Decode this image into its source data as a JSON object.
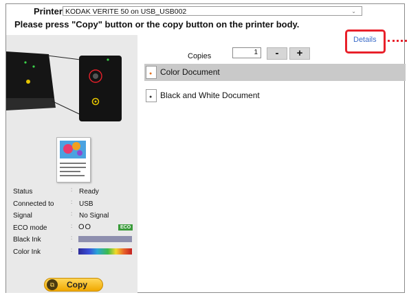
{
  "printer": {
    "label": "Printer:",
    "selected": "KODAK VERITE 50 on USB_USB002"
  },
  "instruction": "Please press \"Copy\" button or the copy button on the printer body.",
  "details_link": "Details",
  "copies": {
    "label": "Copies",
    "value": "1",
    "minus": "-",
    "plus": "+"
  },
  "document_types": [
    {
      "label": "Color Document",
      "selected": true
    },
    {
      "label": "Black and White Document",
      "selected": false
    }
  ],
  "status": {
    "rows": [
      {
        "key": "Status",
        "value": "Ready"
      },
      {
        "key": "Connected to",
        "value": "USB"
      },
      {
        "key": "Signal",
        "value": "No Signal"
      }
    ],
    "eco": {
      "key": "ECO mode",
      "circles": "OO",
      "badge": "ECO"
    },
    "black_ink": {
      "key": "Black Ink"
    },
    "color_ink": {
      "key": "Color Ink"
    }
  },
  "copy_button": {
    "label": "Copy"
  },
  "colors": {
    "highlight": "#e8202a",
    "link": "#3a6bc9",
    "eco": "#3a9b3a",
    "copy": "#f0a800"
  }
}
